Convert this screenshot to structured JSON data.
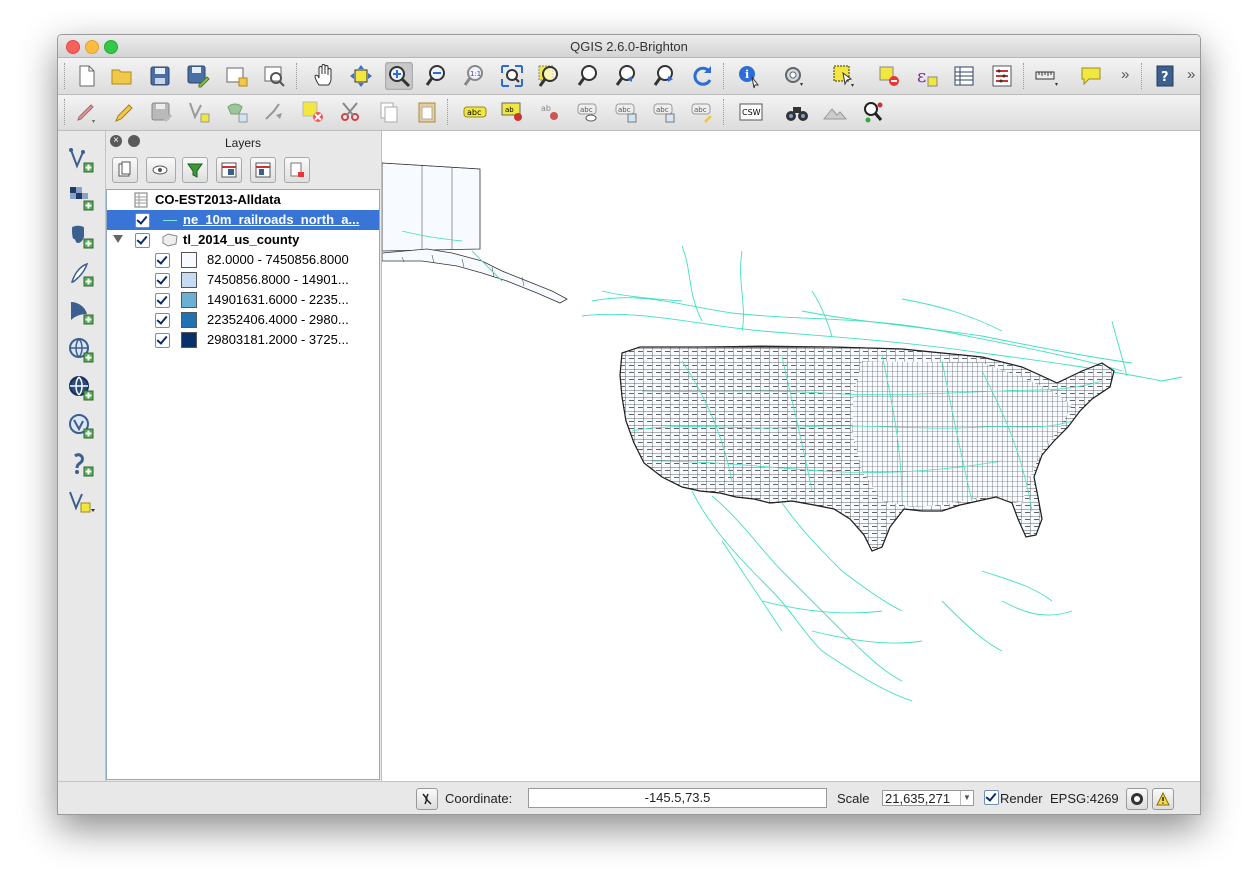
{
  "window": {
    "title": "QGIS 2.6.0-Brighton"
  },
  "toolbar_top": {
    "icons": [
      "new-project-icon",
      "open-project-icon",
      "save-project-icon",
      "save-as-icon",
      "new-print-composer-icon",
      "composer-manager-icon",
      "pan-icon",
      "pan-to-selection-icon",
      "zoom-in-icon",
      "zoom-out-icon",
      "zoom-actual-icon",
      "zoom-full-icon",
      "zoom-to-selection-icon",
      "zoom-to-layer-icon",
      "zoom-last-icon",
      "zoom-next-icon",
      "refresh-icon",
      "identify-icon",
      "run-action-icon",
      "select-features-icon",
      "deselect-icon",
      "field-calculator-icon",
      "attribute-table-icon",
      "statistics-icon",
      "measure-icon",
      "map-tips-icon",
      "help-icon"
    ],
    "overflow": "»"
  },
  "toolbar_second": {
    "label_abc": "abc",
    "label_ab": "ab",
    "csw": "CSW"
  },
  "layers_panel": {
    "title": "Layers",
    "layers": [
      {
        "name": "CO-EST2013-Alldata",
        "type": "table",
        "checked": false,
        "selected": false
      },
      {
        "name": "ne_10m_railroads_north_a...",
        "type": "line",
        "checked": true,
        "selected": true
      },
      {
        "name": "tl_2014_us_county",
        "type": "polygon",
        "checked": true,
        "selected": false,
        "expanded": true
      }
    ],
    "legend": [
      {
        "label": "82.0000 - 7450856.8000",
        "color": "#f7fbff"
      },
      {
        "label": "7450856.8000 - 14901...",
        "color": "#c6dbef"
      },
      {
        "label": "14901631.6000 - 2235...",
        "color": "#6baed6"
      },
      {
        "label": "22352406.4000 - 2980...",
        "color": "#2171b5"
      },
      {
        "label": "29803181.2000 - 3725...",
        "color": "#08306b"
      }
    ]
  },
  "status_bar": {
    "coordinate_label": "Coordinate:",
    "coordinate_value": "-145.5,73.5",
    "scale_label": "Scale",
    "scale_value": "21,635,271",
    "render_label": "Render",
    "render_checked": true,
    "crs": "EPSG:4269"
  },
  "colors": {
    "railroad": "#40e0c0",
    "county_outline": "#333333",
    "selection": "#3875d7"
  }
}
